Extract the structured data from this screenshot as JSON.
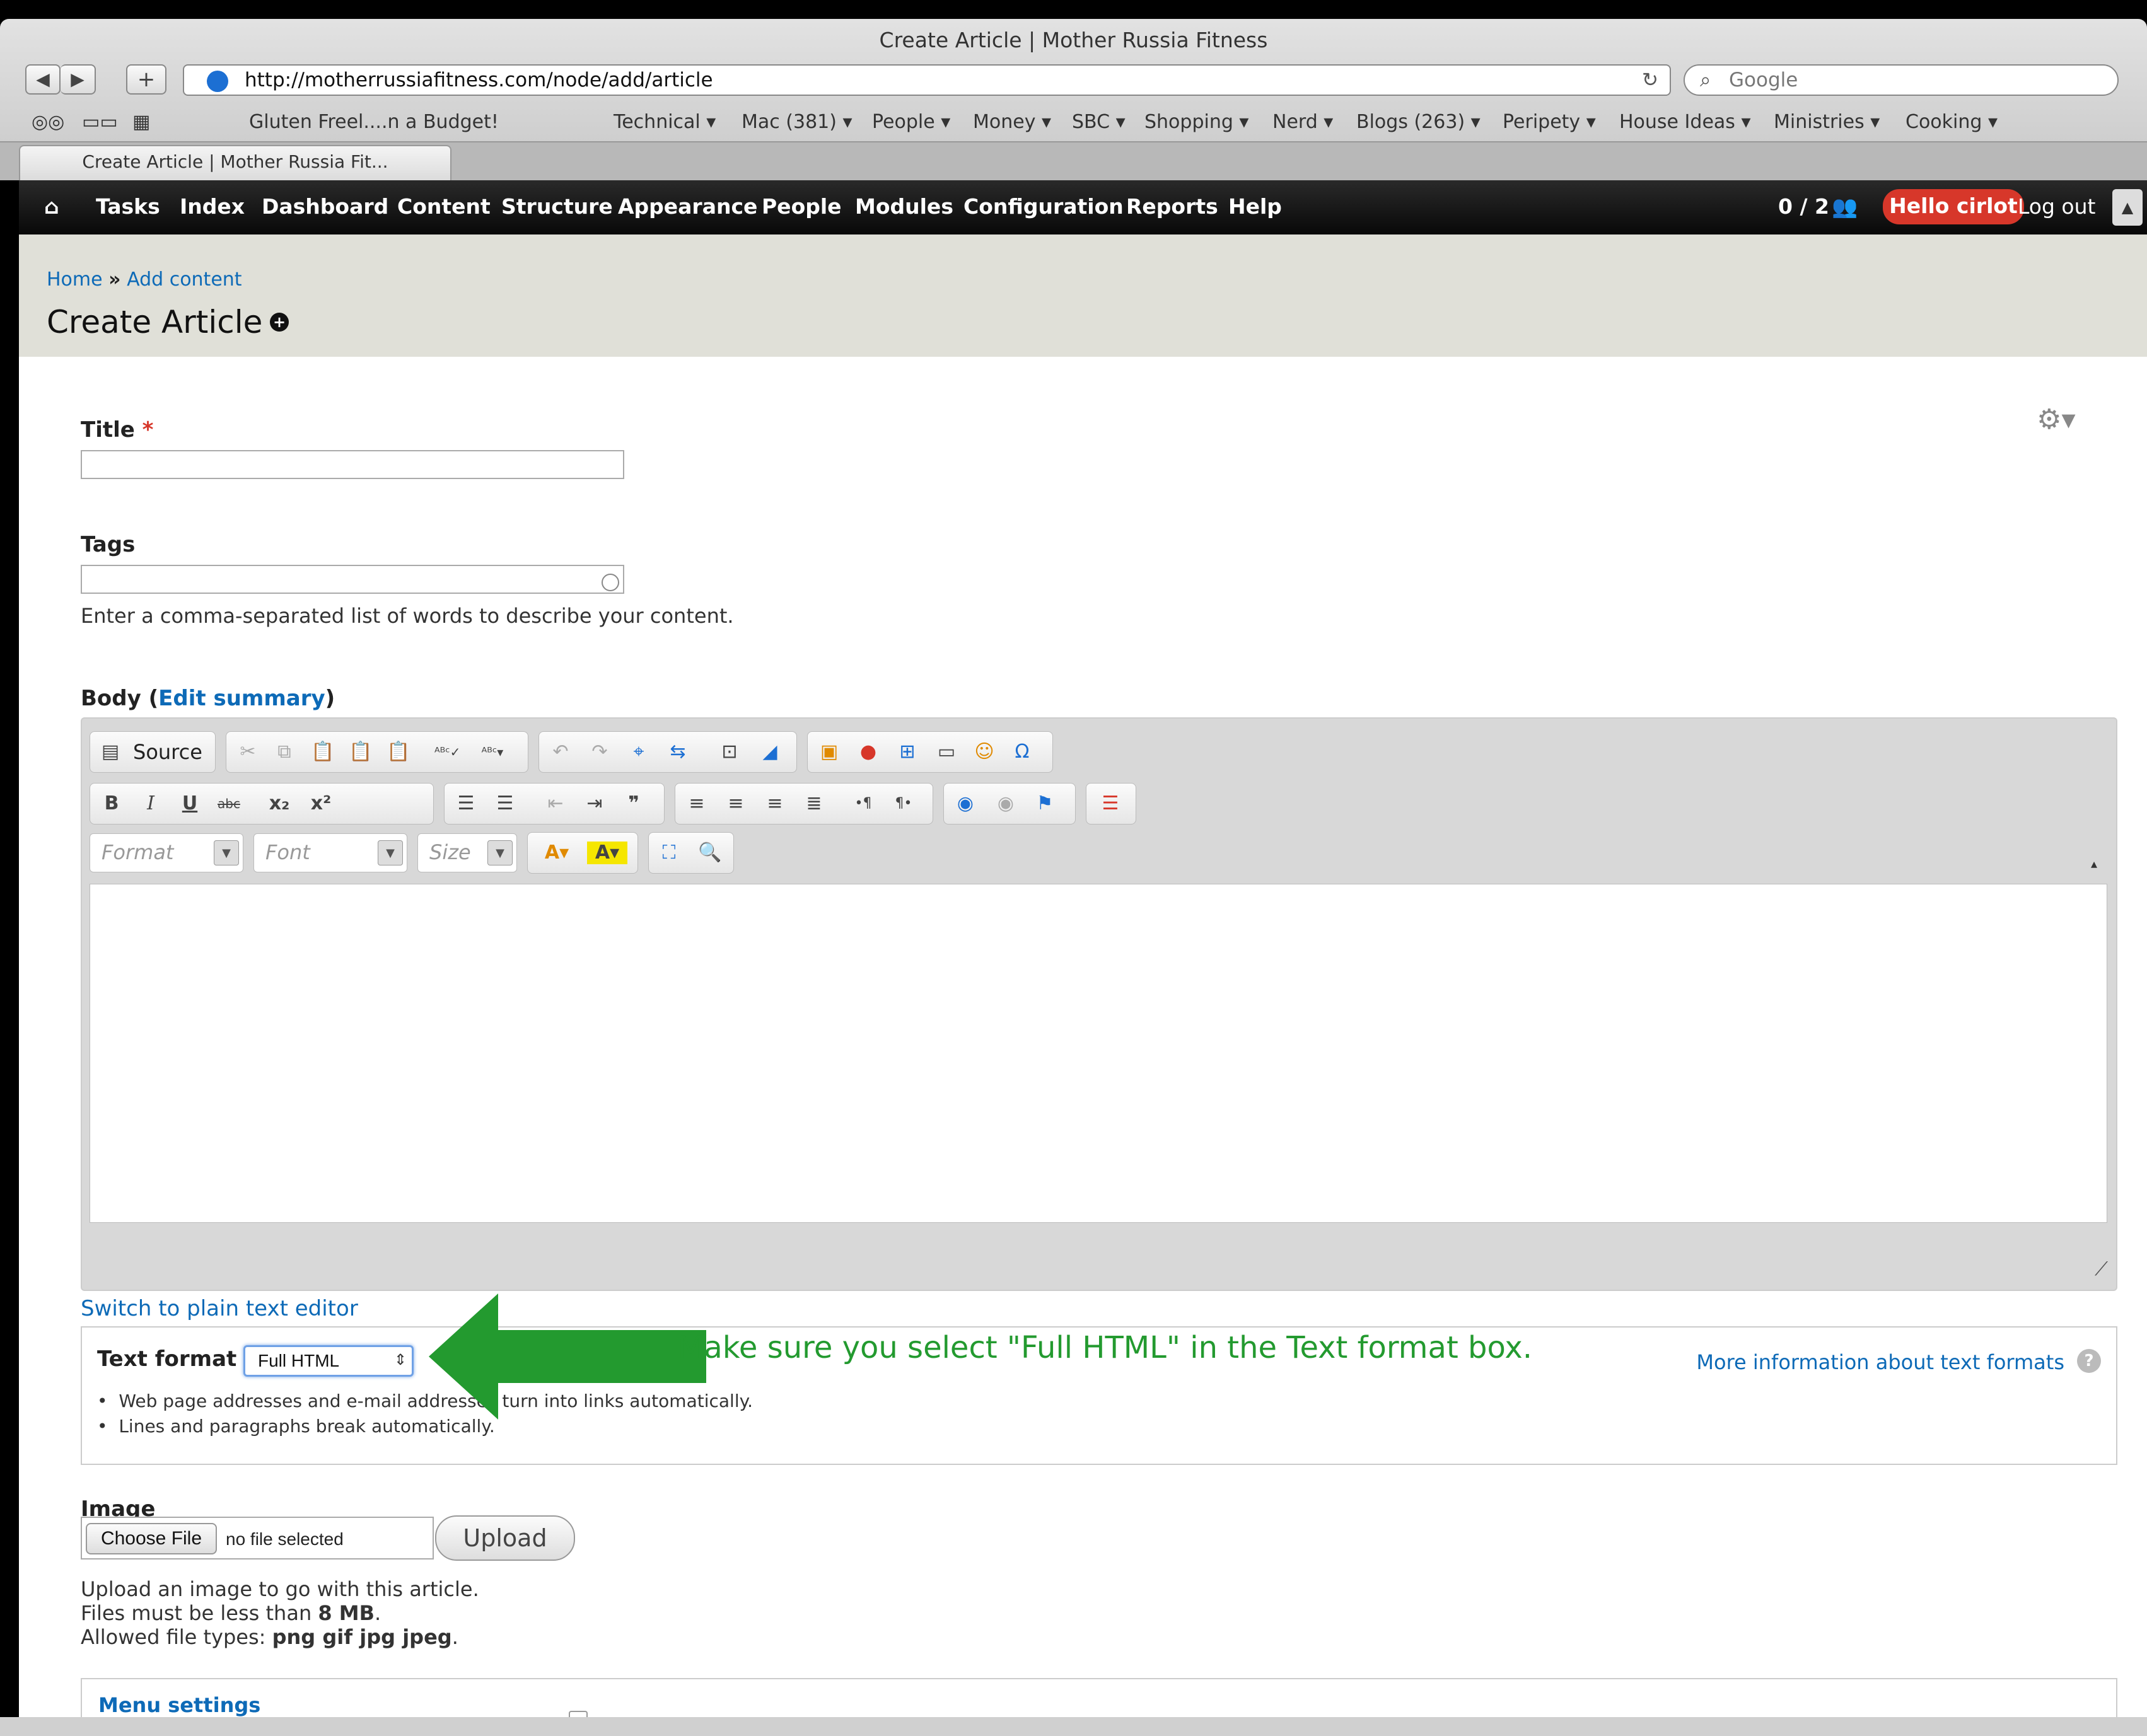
{
  "window": {
    "title": "Create Article | Mother Russia Fitness"
  },
  "nav": {
    "url": "http://motherrussiafitness.com/node/add/article",
    "search_placeholder": "Google",
    "add_label": "+"
  },
  "bookmarks": {
    "first": "Gluten Freel....n a Budget!",
    "items": [
      "Technical ▾",
      "Mac (381) ▾",
      "People ▾",
      "Money ▾",
      "SBC ▾",
      "Shopping ▾",
      "Nerd ▾",
      "Blogs (263) ▾",
      "Peripety ▾",
      "House Ideas ▾",
      "Ministries ▾",
      "Cooking ▾"
    ]
  },
  "tab": {
    "label": "Create Article | Mother Russia Fit..."
  },
  "admin_menu": {
    "items": [
      "Tasks",
      "Index",
      "Dashboard",
      "Content",
      "Structure",
      "Appearance",
      "People",
      "Modules",
      "Configuration",
      "Reports",
      "Help"
    ],
    "user_count": "0 / 2",
    "hello": "Hello cirlot",
    "logout": "Log out"
  },
  "breadcrumb": {
    "home": "Home",
    "sep": "»",
    "current": "Add content"
  },
  "page_title": "Create Article",
  "form": {
    "title_label": "Title",
    "required_mark": "*",
    "tags_label": "Tags",
    "tags_desc": "Enter a comma-separated list of words to describe your content.",
    "body_label": "Body",
    "body_paren_open": "(",
    "edit_summary": "Edit summary",
    "body_paren_close": ")",
    "switch_editor": "Switch to plain text editor",
    "text_format_label": "Text format",
    "text_format_value": "Full HTML",
    "more_info": "More information about text formats",
    "format_tips": [
      "Web page addresses and e-mail addresses turn into links automatically.",
      "Lines and paragraphs break automatically."
    ],
    "annotation": "Make sure you select \"Full HTML\" in the Text format box.",
    "image_label": "Image",
    "choose_file": "Choose File",
    "no_file": "no file selected",
    "upload": "Upload",
    "image_desc_1": "Upload an image to go with this article.",
    "image_desc_2a": "Files must be less than ",
    "image_desc_2b": "8 MB",
    "image_desc_2c": ".",
    "image_desc_3a": "Allowed file types: ",
    "image_desc_3b": "png gif jpg jpeg",
    "image_desc_3c": ".",
    "menu_settings": "Menu settings"
  },
  "editor": {
    "source_label": "Source",
    "format": "Format",
    "font": "Font",
    "size": "Size"
  },
  "colors": {
    "accent_link": "#0d6ab7",
    "hello_badge": "#d7372a",
    "annotation": "#239a2f"
  }
}
